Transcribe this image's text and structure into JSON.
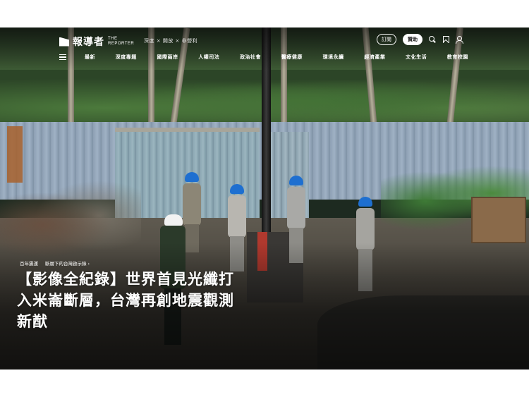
{
  "brand": {
    "name_zh": "報導者",
    "name_en_line1": "THE",
    "name_en_line2": "REPORTER",
    "tagline": "深度 × 開放 × 非營利"
  },
  "header_actions": {
    "subscribe_label": "訂閱",
    "donate_label": "贊助",
    "icons": [
      "search-icon",
      "bookmark-icon",
      "user-icon"
    ]
  },
  "nav": {
    "menu_icon": "hamburger-icon",
    "items": [
      {
        "label": "最新"
      },
      {
        "label": "深度專題"
      },
      {
        "label": "國際兩岸"
      },
      {
        "label": "人權司法"
      },
      {
        "label": "政治社會"
      },
      {
        "label": "醫療健康"
      },
      {
        "label": "環境永續"
      },
      {
        "label": "經濟產業"
      },
      {
        "label": "文化生活"
      },
      {
        "label": "教育校園"
      }
    ]
  },
  "article": {
    "kicker_primary": "百年震運",
    "kicker_secondary": "斷層下的台灣啟示錄",
    "kicker_arrow": "›",
    "headline_line1": "【影像全紀錄】世界首見光纖打",
    "headline_line2": "入米崙斷層，台灣再創地震觀測",
    "headline_line3": "新猷"
  },
  "colors": {
    "page_bg": "#ffffff",
    "header_text": "#ffffff",
    "helmet_blue": "#1e6fd0",
    "helmet_white": "#f2f2f2"
  }
}
